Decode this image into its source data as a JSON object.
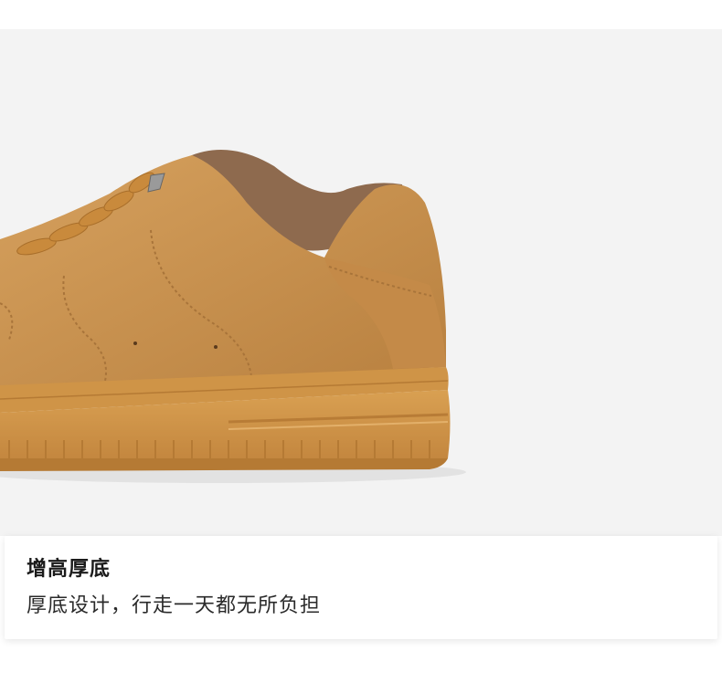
{
  "caption": {
    "title": "增高厚底",
    "description": "厚底设计，行走一天都无所负担"
  },
  "photo": {
    "subject": "shoe-photo",
    "colors": {
      "background": "#f3f3f3",
      "upper": "#c9914f",
      "sole": "#d39a4d",
      "laces": "#c98a3c",
      "lining": "#9a7052"
    }
  }
}
